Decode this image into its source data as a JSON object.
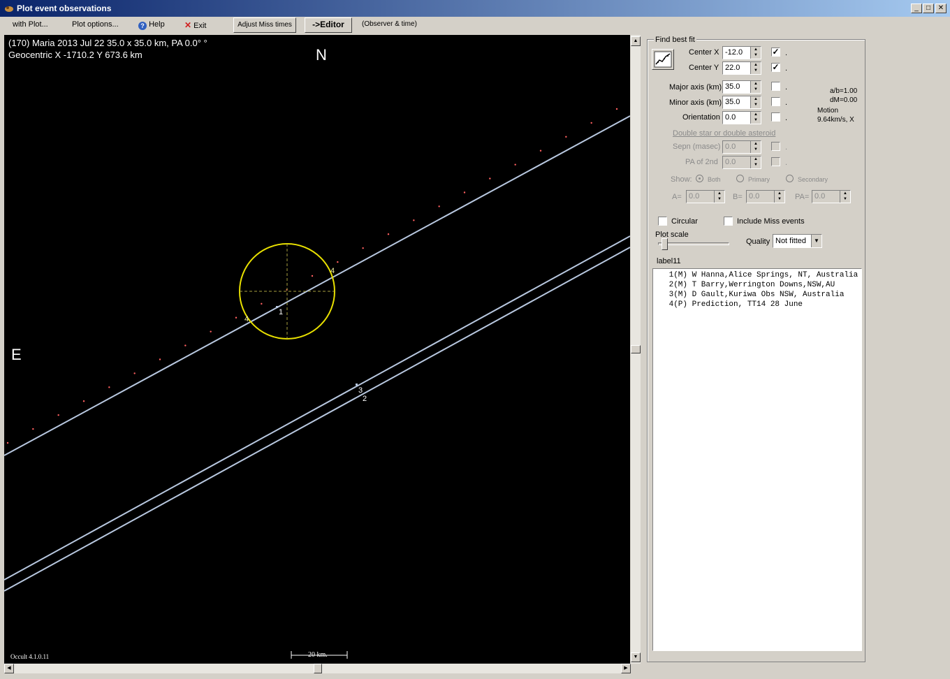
{
  "window": {
    "title": "Plot event observations"
  },
  "menu": {
    "with_plot": "with Plot...",
    "plot_options": "Plot options...",
    "help": "Help",
    "exit": "Exit",
    "adjust_miss": "Adjust Miss times",
    "editor": "->Editor",
    "observer_time": "(Observer & time)"
  },
  "plot": {
    "header_line1": "(170) Maria  2013 Jul 22   35.0 x 35.0 km, PA 0.0° °",
    "header_line2": "Geocentric X -1710.2  Y 673.6 km",
    "north": "N",
    "east": "E",
    "version": "Occult 4.1.0.11",
    "scale": "20 km.",
    "chord_labels": [
      "1",
      "2",
      "3",
      "4",
      "4"
    ],
    "colors": {
      "background": "#000000",
      "chord": "#b8c8e0",
      "ellipse": "#e8e000",
      "prediction": "#ff6060"
    }
  },
  "fit": {
    "group_label": "Find best fit",
    "center_x_label": "Center X",
    "center_x": "-12.0",
    "center_y_label": "Center Y",
    "center_y": "22.0",
    "major_label": "Major axis (km)",
    "major": "35.0",
    "minor_label": "Minor axis (km)",
    "minor": "35.0",
    "orient_label": "Orientation",
    "orient": "0.0",
    "ab": "a/b=1.00",
    "dm": "dM=0.00",
    "motion_label": "Motion",
    "motion_value": "9.64km/s, X",
    "double_label": "Double star  or  double asteroid",
    "sepn_label": "Sepn (masec)",
    "sepn": "0.0",
    "pa2_label": "PA of 2nd",
    "pa2": "0.0",
    "show_label": "Show:",
    "both": "Both",
    "primary": "Primary",
    "secondary": "Secondary",
    "a_label": "A=",
    "a_val": "0.0",
    "b_label": "B=",
    "b_val": "0.0",
    "pa_label": "PA=",
    "pa_val": "0.0",
    "circular": "Circular",
    "include_miss": "Include Miss events",
    "plot_scale": "Plot scale",
    "quality_label": "Quality",
    "quality_value": "Not fitted",
    "label11": "label11"
  },
  "observers": [
    " 1(M) W Hanna,Alice Springs, NT, Australia",
    " 2(M) T Barry,Werrington Downs,NSW,AU",
    " 3(M) D Gault,Kuriwa Obs NSW, Australia",
    " 4(P) Prediction, TT14 28 June"
  ]
}
